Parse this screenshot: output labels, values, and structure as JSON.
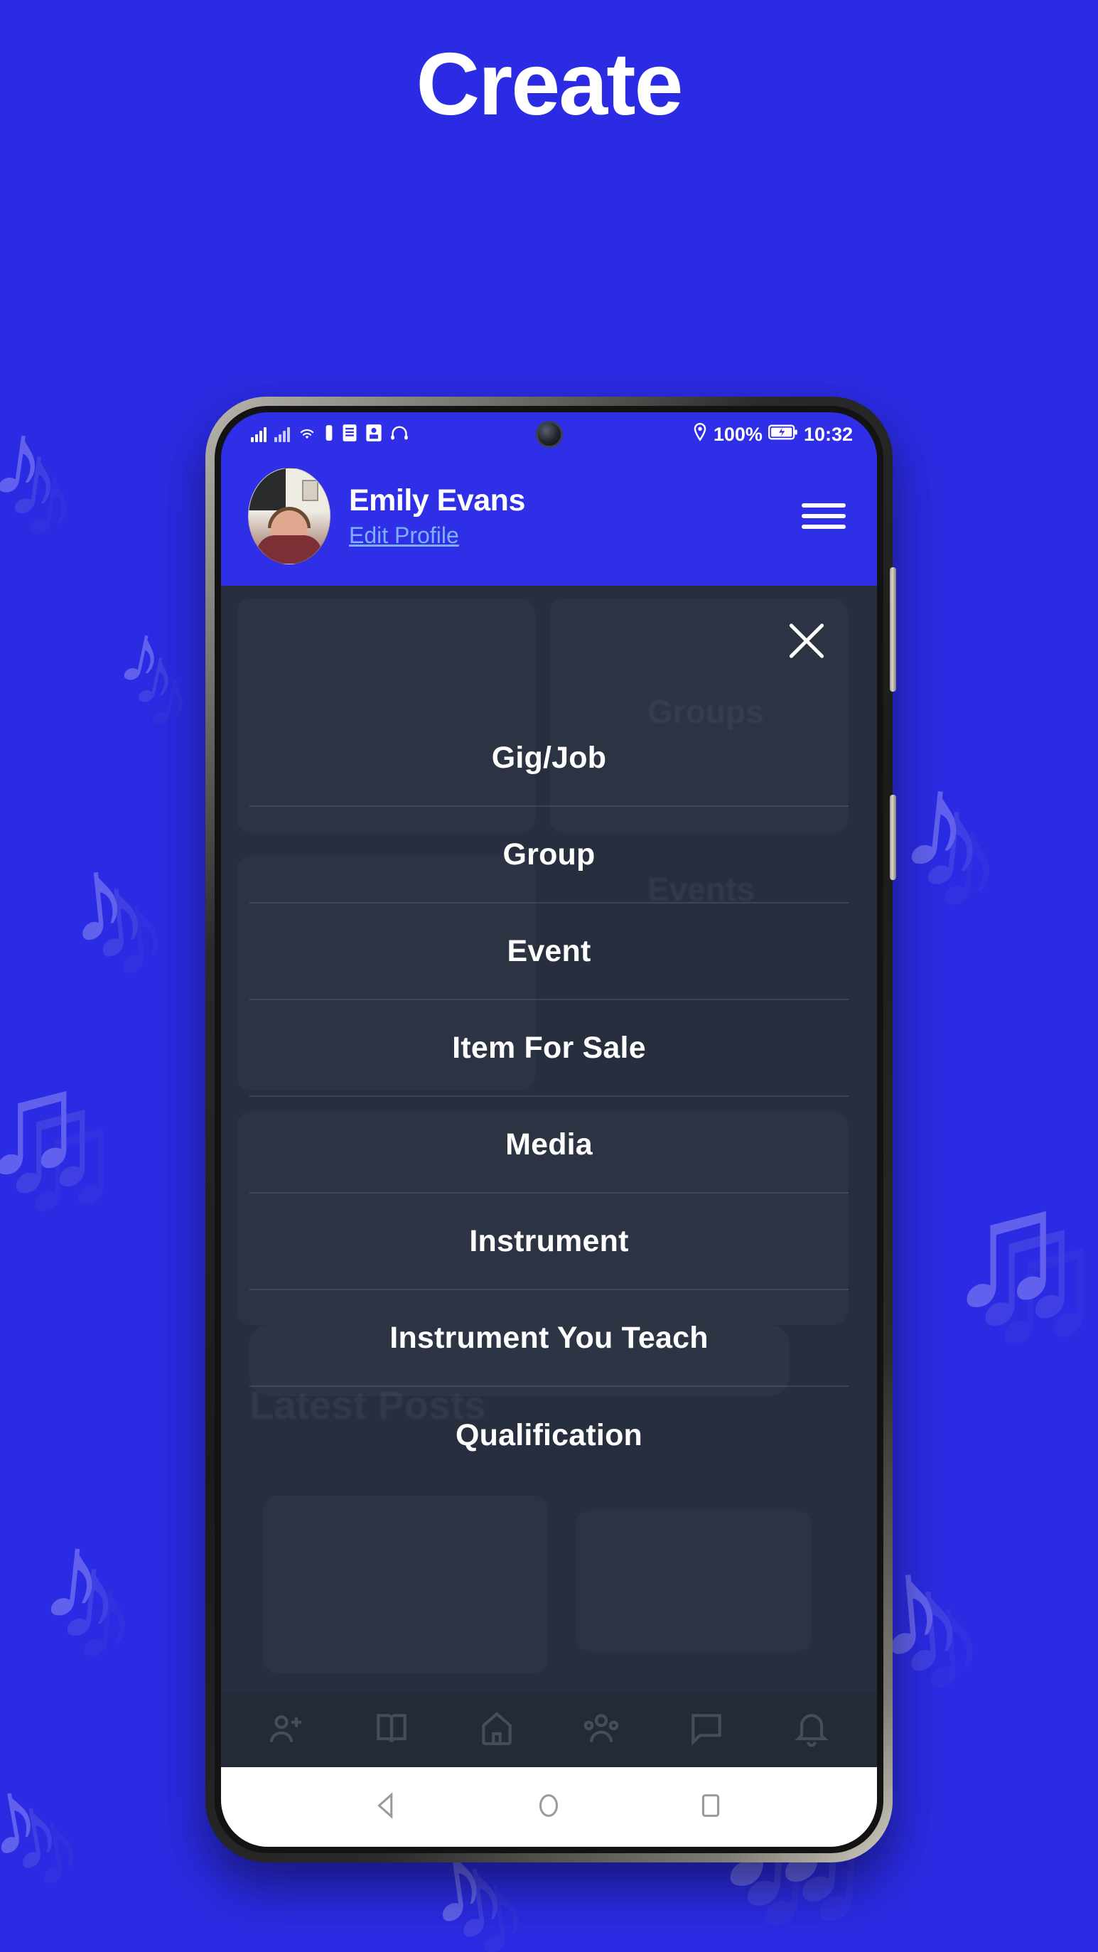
{
  "poster": {
    "title": "Create",
    "background_color": "#2B2BE3",
    "accent_color": "#2F2FE8",
    "app_surface_color": "#272F3E"
  },
  "phone": {
    "status_bar": {
      "signal_icon": "signal-bars-icon",
      "signal_icon_2": "signal-bars-secondary-icon",
      "wifi_icon": "wifi-icon",
      "vibrate_icon": "vibrate-icon",
      "sim_icon": "sim-card-icon",
      "screenshot_icon": "screenshot-icon",
      "headset_icon": "headset-icon",
      "location_icon": "location-pin-icon",
      "battery_percent": "100%",
      "battery_icon": "battery-charging-icon",
      "time": "10:32",
      "camera": "front-camera-punch-hole"
    },
    "header": {
      "avatar": "user-avatar",
      "name": "Emily Evans",
      "edit_profile_label": "Edit Profile",
      "edit_profile_color": "#7FB0FF",
      "menu_icon": "hamburger-menu-icon"
    },
    "overlay": {
      "close_icon": "close-x-icon",
      "menu_items": [
        {
          "label": "Gig/Job"
        },
        {
          "label": "Group"
        },
        {
          "label": "Event"
        },
        {
          "label": "Item For Sale"
        },
        {
          "label": "Media"
        },
        {
          "label": "Instrument"
        },
        {
          "label": "Instrument You Teach"
        },
        {
          "label": "Qualification"
        }
      ]
    },
    "background_content": {
      "ghost_texts": [
        "Groups",
        "Events",
        "Latest Posts"
      ]
    },
    "bottom_nav": {
      "items": [
        {
          "icon": "add-person-icon"
        },
        {
          "icon": "book-icon"
        },
        {
          "icon": "home-icon"
        },
        {
          "icon": "people-group-icon"
        },
        {
          "icon": "chat-bubble-icon"
        },
        {
          "icon": "bell-notification-icon"
        }
      ]
    },
    "android_nav": {
      "back": "back-triangle-icon",
      "home": "home-circle-icon",
      "recents": "recents-square-icon"
    }
  }
}
